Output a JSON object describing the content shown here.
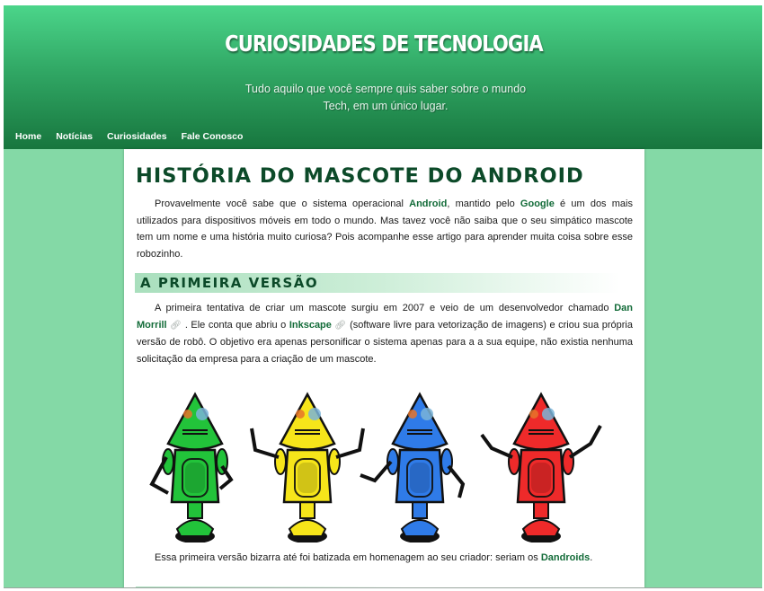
{
  "site": {
    "title": "CURIOSIDADES DE TECNOLOGIA",
    "tagline_line1": "Tudo aquilo que você sempre quis saber sobre o mundo",
    "tagline_line2": "Tech, em um único lugar."
  },
  "nav": {
    "items": [
      "Home",
      "Notícias",
      "Curiosidades",
      "Fale Conosco"
    ]
  },
  "article": {
    "title": "História do mascote do Android",
    "intro": {
      "t1": "Provavelmente você sabe que o sistema operacional ",
      "link1": "Android",
      "t2": ", mantido pelo ",
      "link2": "Google",
      "t3": " é um dos mais utilizados para dispositivos móveis em todo o mundo. Mas tavez você não saiba que o seu simpático mascote tem um nome e uma história muito curiosa? Pois acompanhe esse artigo para aprender muita coisa sobre esse robozinho."
    },
    "section1_title": "A primeira versão",
    "section1": {
      "t1": "A primeira tentativa de criar um mascote surgiu em 2007 e veio de um desenvolvedor chamado ",
      "link1": "Dan Morrill",
      "t2": " . Ele conta que abriu o ",
      "link2": "Inkscape",
      "t3": "  (software livre para vetorização de imagens) e criou sua própria versão de robô. O objetivo era apenas personificar o sistema apenas para a a sua equipe, não existia nenhuma solicitação da empresa para a criação de um mascote."
    },
    "closing": {
      "t1": "Essa primeira versão bizarra até foi batizada em homenagem ao seu criador: seriam os ",
      "link1": "Dandroids",
      "t2": "."
    }
  },
  "icons": {
    "external_link": "external-link-icon"
  },
  "colors": {
    "header_top": "#4bd58a",
    "header_bottom": "#17763e",
    "page_bg": "#84d9a6",
    "title_color": "#0c4a29",
    "link_color": "#126b38",
    "robots": [
      "#22c33a",
      "#f6e51a",
      "#2f7be8",
      "#ee2a2a"
    ]
  }
}
